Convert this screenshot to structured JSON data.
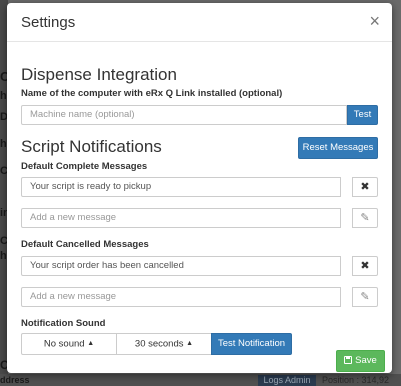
{
  "background": {
    "bottom_button": "Logs Admin",
    "bottom_position_text": "Position : 314,92",
    "left_fragments": [
      "C",
      "ha",
      "D",
      "he",
      "Cl",
      "in",
      "Ch",
      "he",
      "C",
      "ddress"
    ]
  },
  "modal": {
    "title": "Settings",
    "close_glyph": "×",
    "dispense": {
      "title": "Dispense Integration",
      "label": "Name of the computer with eRx Q Link installed (optional)",
      "placeholder": "Machine name  (optional)",
      "test_button": "Test"
    },
    "script_notifications": {
      "title": "Script Notifications",
      "reset_button": "Reset Messages",
      "complete_label": "Default Complete Messages",
      "complete_message": "Your script is ready to pickup",
      "complete_add_placeholder": "Add a new message",
      "cancelled_label": "Default Cancelled Messages",
      "cancelled_message": "Your script order has been cancelled",
      "cancelled_add_placeholder": "Add a new message",
      "remove_glyph": "✖",
      "edit_glyph": "✎"
    },
    "sound": {
      "label": "Notification Sound",
      "sound_option": "No sound",
      "interval_option": "30 seconds",
      "caret": "▲",
      "test_button": "Test Notification"
    },
    "save_button": "Save",
    "save_icon": "💾"
  },
  "colors": {
    "primary": "#337ab7",
    "success": "#5cb85c"
  }
}
